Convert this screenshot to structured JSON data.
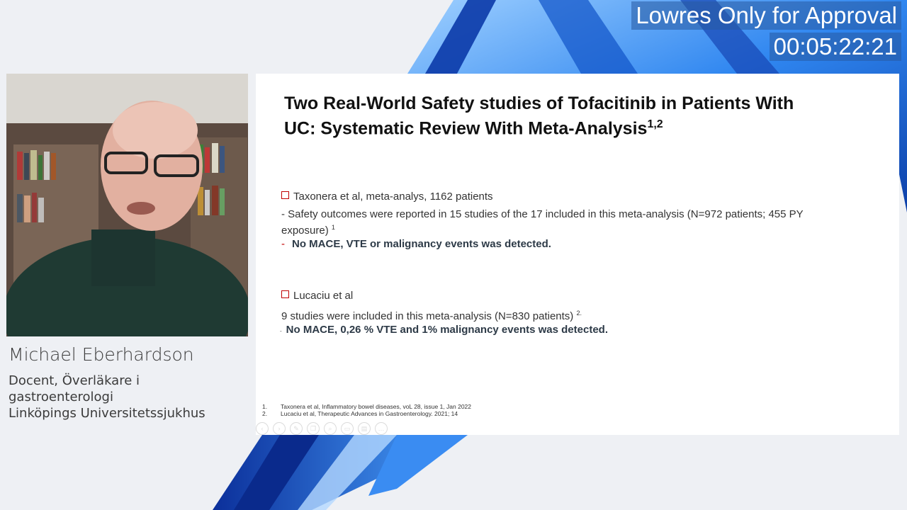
{
  "watermark": {
    "title": "Lowres Only for Approval",
    "timecode": "00:05:22:21"
  },
  "speaker": {
    "name": "Michael Eberhardson",
    "lines": [
      "Docent, Överläkare i",
      "gastroenterologi",
      "Linköpings Universitetssjukhus"
    ]
  },
  "slide": {
    "title_line1": "Two Real-World Safety studies of Tofacitinib in Patients With",
    "title_line2": "UC: Systematic Review With Meta-Analysis",
    "title_sup": "1,2",
    "study1": {
      "heading": "Taxonera et al, meta-analys, 1162 patients",
      "detail": "- Safety outcomes were reported in 15 studies of the 17 included in this meta-analysis (N=972 patients; 455 PY exposure)",
      "detail_sup": "1",
      "dash": "-",
      "finding": "No MACE, VTE or malignancy events was detected."
    },
    "study2": {
      "heading": "Lucaciu et al",
      "detail": "9 studies were included in this meta-analysis (N=830 patients)",
      "detail_sup": "2.",
      "dash": "-",
      "finding": "No MACE, 0,26 % VTE and 1% malignancy events was detected."
    },
    "references": [
      {
        "num": "1.",
        "text": "Taxonera et al, Inflammatory bowel diseases, voL 28, issue 1, Jan 2022"
      },
      {
        "num": "2.",
        "text": "Lucaciu et al, Therapeutic Advances in Gastroenterology. 2021; 14"
      }
    ]
  },
  "toolbar_icons": [
    "back-icon",
    "forward-icon",
    "pen-icon",
    "copy-icon",
    "zoom-icon",
    "screen-icon",
    "subtitle-icon",
    "more-icon"
  ],
  "colors": {
    "background": "#eef0f4",
    "accent_blue": "#1f6fd6",
    "bullet_red": "#c00000"
  }
}
